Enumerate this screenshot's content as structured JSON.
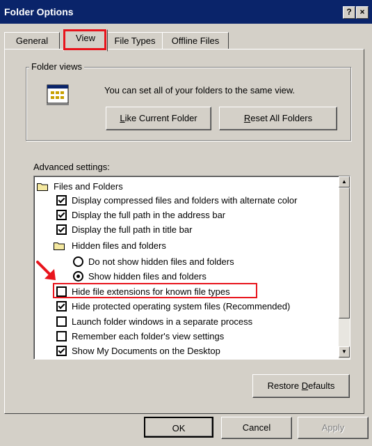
{
  "window": {
    "title": "Folder Options",
    "help_label": "?",
    "close_label": "×"
  },
  "tabs": [
    {
      "label": "General"
    },
    {
      "label": "View",
      "active": true
    },
    {
      "label": "File Types"
    },
    {
      "label": "Offline Files"
    }
  ],
  "folder_views": {
    "group_label": "Folder views",
    "description": "You can set all of your folders to the same view.",
    "like_current_prefix": "",
    "like_current_key": "L",
    "like_current_rest": "ike Current Folder",
    "reset_all_key": "R",
    "reset_all_rest": "eset All Folders"
  },
  "advanced": {
    "label": "Advanced settings:",
    "items": [
      {
        "type": "folder",
        "label": "Files and Folders"
      },
      {
        "type": "checkbox",
        "checked": true,
        "label": "Display compressed files and folders with alternate color"
      },
      {
        "type": "checkbox",
        "checked": true,
        "label": "Display the full path in the address bar"
      },
      {
        "type": "checkbox",
        "checked": true,
        "label": "Display the full path in title bar"
      },
      {
        "type": "folder",
        "label": "Hidden files and folders"
      },
      {
        "type": "radio",
        "checked": false,
        "label": "Do not show hidden files and folders"
      },
      {
        "type": "radio",
        "checked": true,
        "label": "Show hidden files and folders"
      },
      {
        "type": "checkbox",
        "checked": false,
        "label": "Hide file extensions for known file types"
      },
      {
        "type": "checkbox",
        "checked": true,
        "label": "Hide protected operating system files (Recommended)"
      },
      {
        "type": "checkbox",
        "checked": false,
        "label": "Launch folder windows in a separate process"
      },
      {
        "type": "checkbox",
        "checked": false,
        "label": "Remember each folder's view settings"
      },
      {
        "type": "checkbox",
        "checked": true,
        "label": "Show My Documents on the Desktop"
      }
    ],
    "scroll_up": "▲",
    "scroll_down": "▼"
  },
  "restore_defaults": {
    "prefix": "Restore ",
    "key": "D",
    "rest": "efaults"
  },
  "footer": {
    "ok_label": "OK",
    "cancel_label": "Cancel",
    "apply_label": "Apply"
  },
  "colors": {
    "titlebar": "#0a246a",
    "face": "#d4d0c8",
    "highlight": "#e8141c"
  }
}
